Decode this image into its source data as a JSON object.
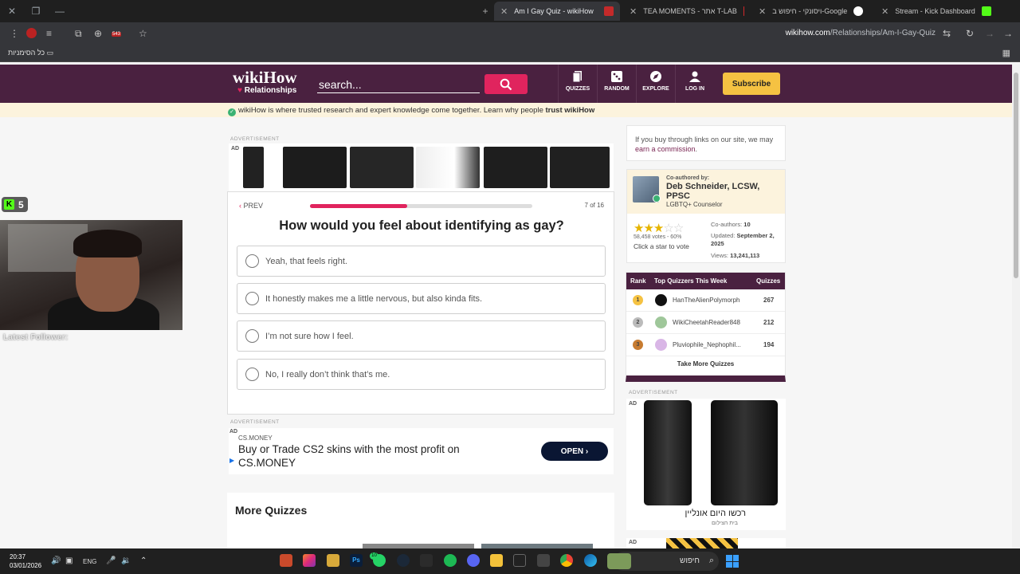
{
  "browser": {
    "tabs": [
      {
        "title": "Am I Gay Quiz - wikiHow",
        "active": true
      },
      {
        "title": "TEA MOMENTS - אתר T-LAB",
        "active": false
      },
      {
        "title": "ויסונקי - חיפוש ב-Google",
        "active": false
      },
      {
        "title": "Stream - Kick Dashboard",
        "active": false
      }
    ],
    "url_host": "wikihow.com",
    "url_path": "/Relationships/Am-I-Gay-Quiz",
    "bookmarks_label": "כל הסימניות",
    "extension_badge": "543"
  },
  "header": {
    "logo_word": "wikiHow",
    "logo_sub": "Relationships",
    "search_placeholder": "search...",
    "nav": [
      {
        "label": "QUIZZES",
        "icon": "quizzes-icon"
      },
      {
        "label": "RANDOM",
        "icon": "dice-icon"
      },
      {
        "label": "EXPLORE",
        "icon": "compass-icon"
      },
      {
        "label": "LOG IN",
        "icon": "user-icon"
      }
    ],
    "subscribe": "Subscribe",
    "accent": "#4a2140"
  },
  "trust": {
    "text": "wikiHow is where trusted research and expert knowledge come together. Learn why people",
    "bold": "trust wikiHow"
  },
  "overlay": {
    "kick_count": "5",
    "latest_follower": "Latest Follower:"
  },
  "ads": {
    "label": "ADVERTISEMENT",
    "tag": "AD",
    "cs_brand": "CS.MONEY",
    "cs_text": "Buy or Trade CS2 skins with the most profit on CS.MONEY",
    "cs_open": "OPEN",
    "lens_heb": "רכשו היום אונליין",
    "lens_heb2": "בית הצילום"
  },
  "quiz": {
    "prev": "PREV",
    "progress": 0.4375,
    "count": "7 of 16",
    "question": "How would you feel about identifying as gay?",
    "options": [
      "Yeah, that feels right.",
      "It honestly makes me a little nervous, but also kinda fits.",
      "I’m not sure how I feel.",
      "No, I really don’t think that’s me."
    ]
  },
  "more_quizzes": "More Quizzes",
  "sidebar": {
    "affiliate_text": "If you buy through links on our site, we may",
    "affiliate_link": "earn a commission",
    "affiliate_end": ".",
    "coauthored": "Co-authored by:",
    "author": "Deb Schneider, LCSW, PPSC",
    "role": "LGBTQ+ Counselor",
    "rating_stars": 3,
    "votes": "58,458 votes - 60%",
    "click_vote": "Click a star to vote",
    "coauthors_label": "Co-authors:",
    "coauthors": "10",
    "updated_label": "Updated:",
    "updated": "September 2, 2025",
    "views_label": "Views:",
    "views": "13,241,113",
    "quizzers_head": {
      "rank": "Rank",
      "title": "Top Quizzers This Week",
      "quizzes": "Quizzes"
    },
    "quizzers": [
      {
        "rank": "1",
        "name": "HanTheAlienPolymorph",
        "score": "267"
      },
      {
        "rank": "2",
        "name": "WikiCheetahReader848",
        "score": "212"
      },
      {
        "rank": "3",
        "name": "Pluviophile_Nephophil...",
        "score": "194"
      }
    ],
    "take_more": "Take More Quizzes"
  },
  "taskbar": {
    "time": "20:37",
    "date": "03/01/2026",
    "lang": "ENG",
    "search": "חיפוש",
    "whatsapp_badge": "10"
  }
}
